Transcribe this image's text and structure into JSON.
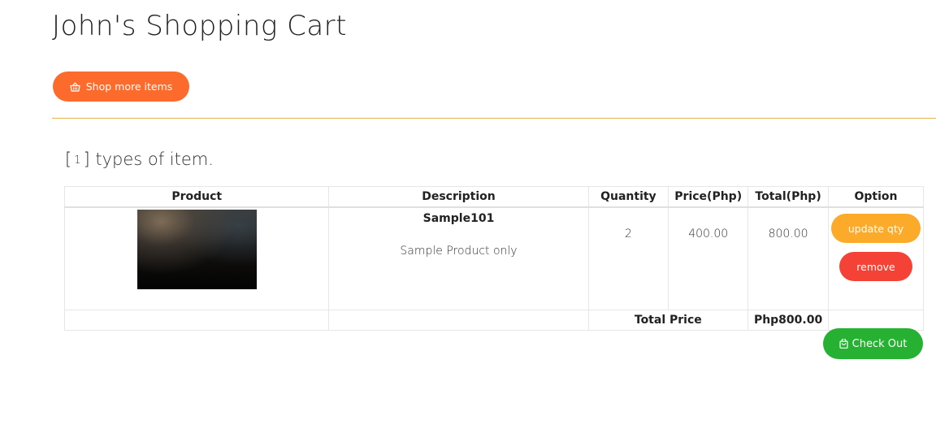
{
  "page": {
    "title": "John's Shopping Cart"
  },
  "toolbar": {
    "shop_more_label": "Shop more items",
    "shop_more_icon": "basket-icon",
    "accent_color": "#fd6b2c",
    "divider_color": "#e8b24a"
  },
  "summary": {
    "open_bracket": "[",
    "item_type_count": "1",
    "close_text": "] types of item."
  },
  "table": {
    "headers": {
      "product": "Product",
      "description": "Description",
      "quantity": "Quantity",
      "price": "Price(Php)",
      "total": "Total(Php)",
      "option": "Option"
    },
    "rows": [
      {
        "name": "Sample101",
        "description": "Sample Product only",
        "quantity": "2",
        "price": "400.00",
        "total": "800.00",
        "update_label": "update qty",
        "remove_label": "remove"
      }
    ],
    "footer": {
      "total_label": "Total Price",
      "total_value": "Php800.00"
    }
  },
  "checkout": {
    "label": "Check Out",
    "icon": "shopping-bag-icon",
    "color": "#27b133"
  },
  "colors": {
    "update_button": "#fbaa2a",
    "remove_button": "#f44336"
  }
}
